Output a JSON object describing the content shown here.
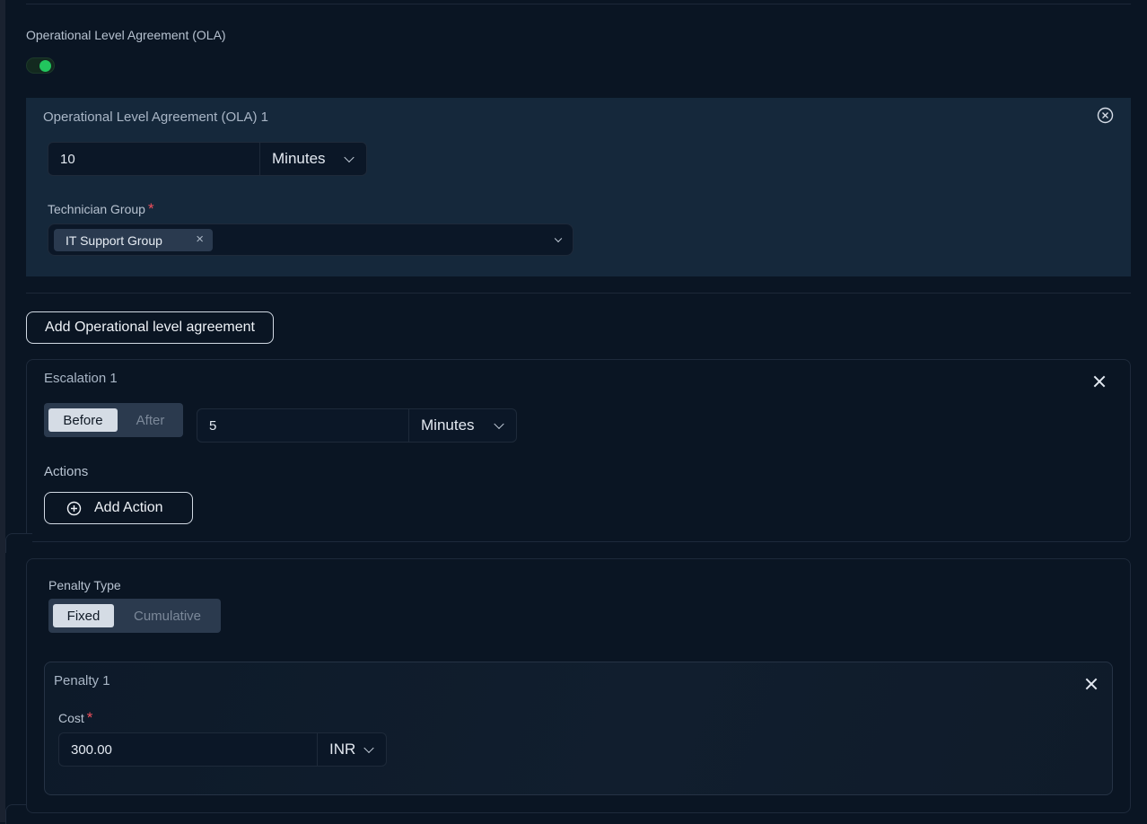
{
  "ola": {
    "section_label": "Operational Level Agreement (OLA)",
    "toggle_on": true,
    "items": [
      {
        "title": "Operational Level Agreement (OLA) 1",
        "duration_value": "10",
        "duration_unit": "Minutes",
        "technician_group_label": "Technician Group",
        "required_marker": "*",
        "technician_groups": [
          "IT Support Group"
        ]
      }
    ],
    "add_button_label": "Add Operational level agreement"
  },
  "escalations": [
    {
      "title": "Escalation 1",
      "timing_options": [
        "Before",
        "After"
      ],
      "timing_selected": "Before",
      "duration_value": "5",
      "duration_unit": "Minutes",
      "actions_label": "Actions",
      "add_action_label": "Add Action"
    }
  ],
  "penalty": {
    "type_label": "Penalty Type",
    "type_options": [
      "Fixed",
      "Cumulative"
    ],
    "type_selected": "Fixed",
    "items": [
      {
        "title": "Penalty 1",
        "cost_label": "Cost",
        "required_marker": "*",
        "cost_value": "300.00",
        "currency": "INR"
      }
    ]
  },
  "colors": {
    "background": "#0a1523",
    "panel": "#15283b",
    "toggle_on": "#22c55e",
    "required": "#ef4f5c"
  }
}
